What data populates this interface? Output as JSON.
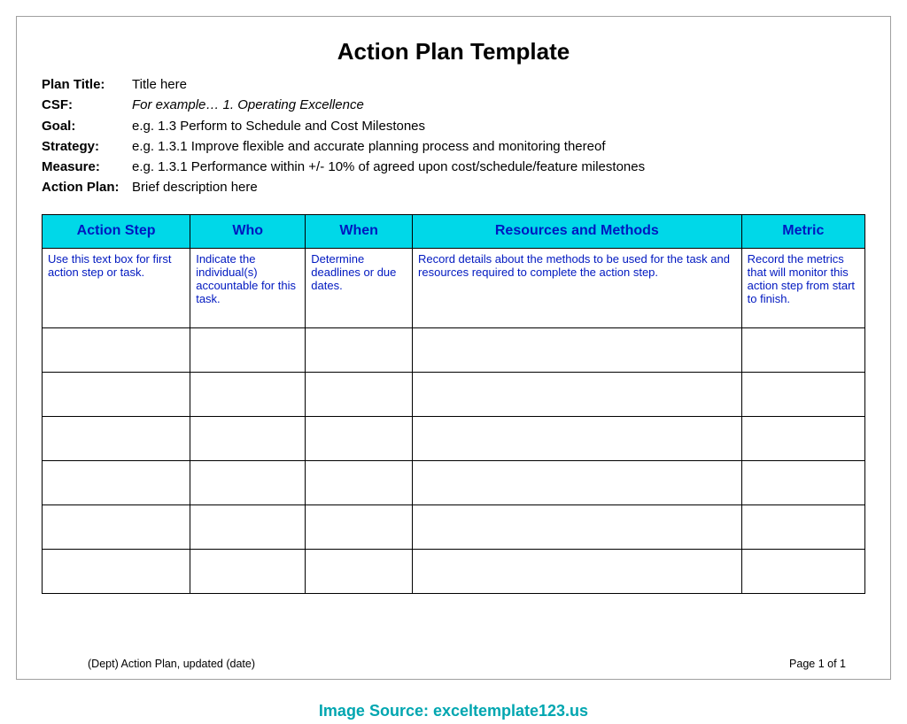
{
  "title": "Action Plan Template",
  "metadata": [
    {
      "label": "Plan Title:",
      "value": "Title here",
      "italic": false
    },
    {
      "label": "CSF:",
      "value": "For example… 1. Operating Excellence",
      "italic": true
    },
    {
      "label": "Goal:",
      "value": "e.g. 1.3  Perform to Schedule and Cost Milestones",
      "italic": false
    },
    {
      "label": "Strategy:",
      "value": "e.g. 1.3.1  Improve flexible and accurate planning process and monitoring thereof",
      "italic": false
    },
    {
      "label": "Measure:",
      "value": "e.g. 1.3.1  Performance within +/- 10% of agreed upon cost/schedule/feature milestones",
      "italic": false
    },
    {
      "label": "Action Plan:",
      "value": "Brief description here",
      "italic": false
    }
  ],
  "table": {
    "headers": [
      "Action Step",
      "Who",
      "When",
      "Resources and Methods",
      "Metric"
    ],
    "instructions": [
      "Use this text box for first action step or task.",
      "Indicate the individual(s) accountable for this task.",
      "Determine deadlines or due dates.",
      "Record details about the methods to be used for the task and resources required to complete the action step.",
      "Record the metrics that will monitor this action step from start to finish."
    ],
    "empty_rows": 6
  },
  "footer": {
    "left": "(Dept) Action Plan, updated (date)",
    "right": "Page 1 of 1"
  },
  "source_credit": "Image Source: exceltemplate123.us"
}
